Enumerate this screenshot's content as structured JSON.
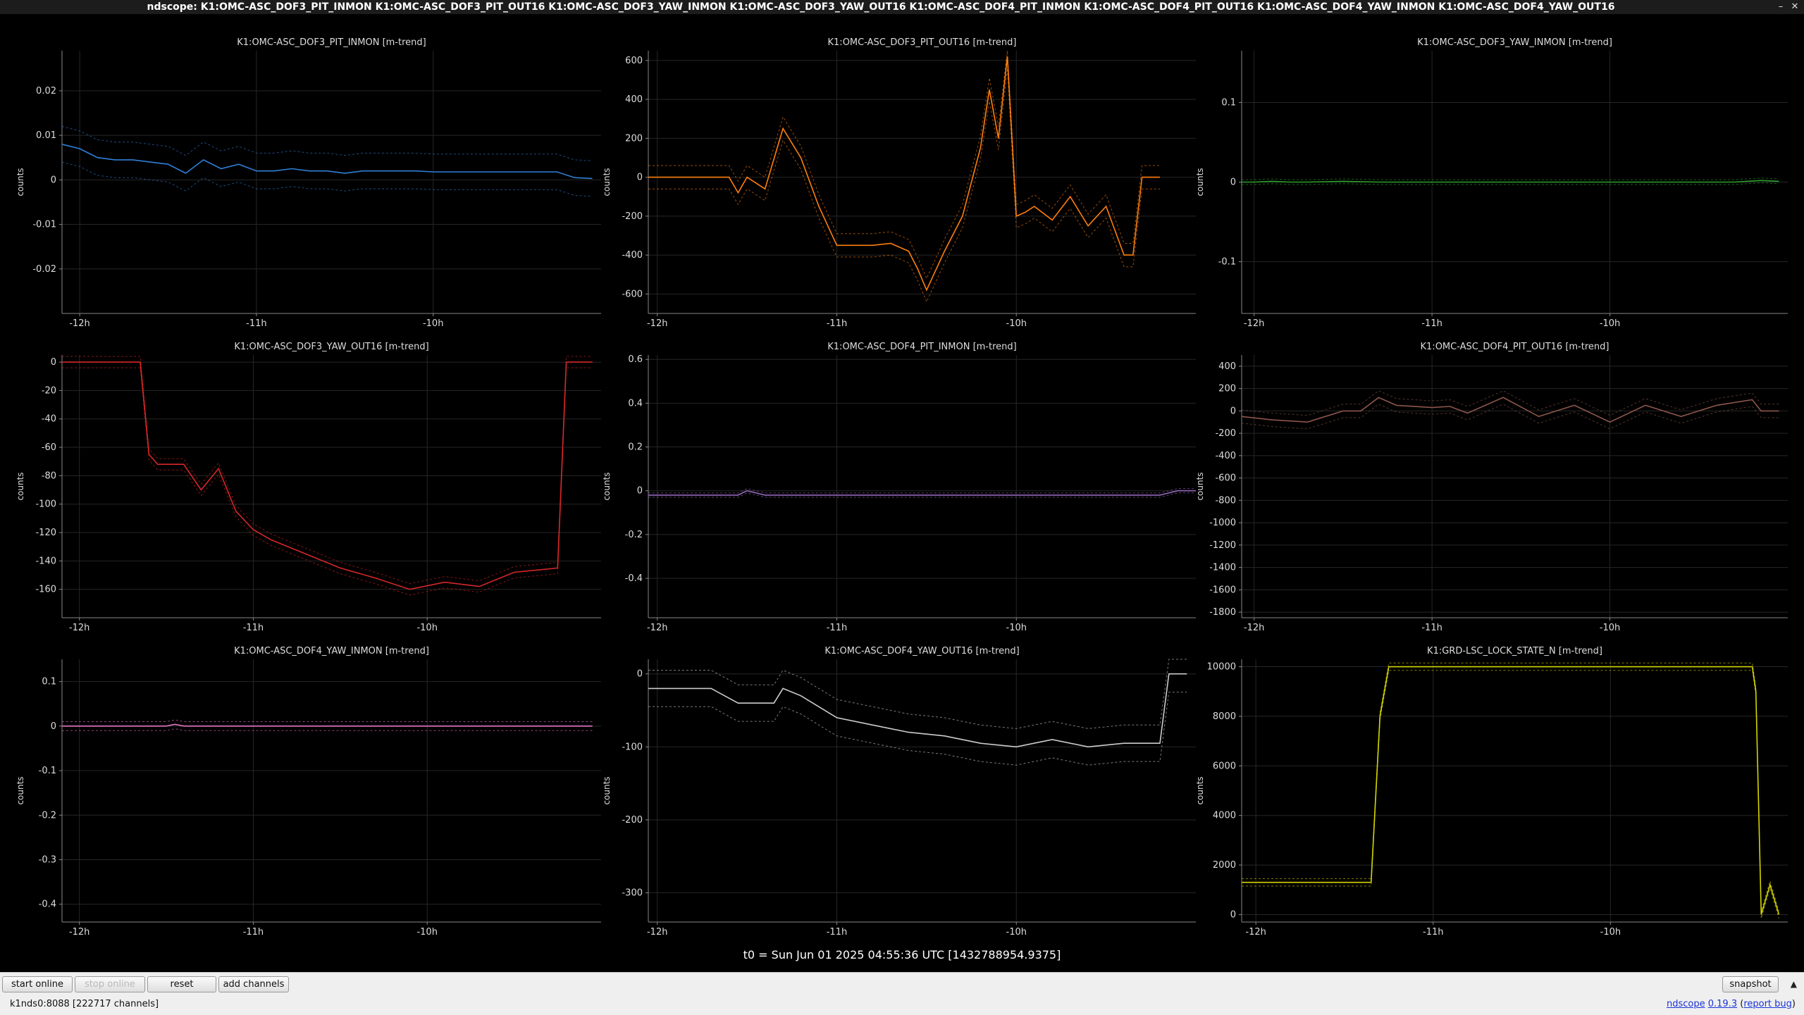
{
  "window": {
    "title": "ndscope: K1:OMC-ASC_DOF3_PIT_INMON K1:OMC-ASC_DOF3_PIT_OUT16 K1:OMC-ASC_DOF3_YAW_INMON K1:OMC-ASC_DOF3_YAW_OUT16 K1:OMC-ASC_DOF4_PIT_INMON K1:OMC-ASC_DOF4_PIT_OUT16 K1:OMC-ASC_DOF4_YAW_INMON K1:OMC-ASC_DOF4_YAW_OUT16",
    "minimize_icon": "minimize-icon",
    "close_icon": "close-icon"
  },
  "t0_label": "t0 = Sun Jun 01 2025 04:55:36 UTC [1432788954.9375]",
  "toolbar": {
    "start_online": "start online",
    "stop_online": "stop online",
    "reset": "reset",
    "add_channels": "add channels",
    "snapshot": "snapshot",
    "collapse_icon": "chevron-up-icon"
  },
  "status": {
    "server": "k1nds0:8088  [222717 channels]",
    "app_name": "ndscope",
    "version": "0.19.3",
    "report_bug": "report bug"
  },
  "chart_data": [
    {
      "type": "line",
      "title": "K1:OMC-ASC_DOF3_PIT_INMON [m-trend]",
      "ylabel": "counts",
      "color": "#2f7fd6",
      "xticks": [
        "-12h",
        "-11h",
        "-10h"
      ],
      "xlim": [
        -12.1,
        -9.05
      ],
      "ylim": [
        -0.03,
        0.029
      ],
      "yticks": [
        0.02,
        0.01,
        0,
        -0.01,
        -0.02
      ],
      "ytick_labels": [
        "0.02",
        "0.01",
        "0",
        "-0.01",
        "-0.02"
      ],
      "x": [
        -12.1,
        -12.0,
        -11.9,
        -11.8,
        -11.7,
        -11.6,
        -11.5,
        -11.4,
        -11.3,
        -11.2,
        -11.1,
        -11.0,
        -10.9,
        -10.8,
        -10.7,
        -10.6,
        -10.5,
        -10.4,
        -10.3,
        -10.2,
        -10.1,
        -10.0,
        -9.9,
        -9.8,
        -9.7,
        -9.6,
        -9.5,
        -9.4,
        -9.3,
        -9.2,
        -9.1
      ],
      "y": [
        0.008,
        0.007,
        0.005,
        0.0045,
        0.0045,
        0.004,
        0.0035,
        0.0015,
        0.0045,
        0.0025,
        0.0035,
        0.002,
        0.002,
        0.0025,
        0.002,
        0.002,
        0.0015,
        0.002,
        0.002,
        0.002,
        0.002,
        0.0018,
        0.0018,
        0.0018,
        0.0018,
        0.0018,
        0.0018,
        0.0018,
        0.0018,
        0.0005,
        0.0003
      ],
      "band": 0.004
    },
    {
      "type": "line",
      "title": "K1:OMC-ASC_DOF3_PIT_OUT16 [m-trend]",
      "ylabel": "counts",
      "color": "#ff7f0e",
      "xticks": [
        "-12h",
        "-11h",
        "-10h"
      ],
      "xlim": [
        -12.05,
        -9.0
      ],
      "ylim": [
        -700,
        650
      ],
      "yticks": [
        600,
        400,
        200,
        0,
        -200,
        -400,
        -600
      ],
      "ytick_labels": [
        "600",
        "400",
        "200",
        "0",
        "-200",
        "-400",
        "-600"
      ],
      "x": [
        -12.05,
        -11.9,
        -11.7,
        -11.6,
        -11.55,
        -11.5,
        -11.4,
        -11.3,
        -11.2,
        -11.1,
        -11.0,
        -10.9,
        -10.8,
        -10.7,
        -10.6,
        -10.55,
        -10.5,
        -10.4,
        -10.3,
        -10.2,
        -10.15,
        -10.1,
        -10.05,
        -10.0,
        -9.95,
        -9.9,
        -9.8,
        -9.7,
        -9.6,
        -9.5,
        -9.4,
        -9.35,
        -9.3,
        -9.2
      ],
      "y": [
        0,
        0,
        0,
        0,
        -80,
        0,
        -60,
        250,
        100,
        -150,
        -350,
        -350,
        -350,
        -340,
        -380,
        -470,
        -580,
        -380,
        -200,
        150,
        450,
        200,
        620,
        -200,
        -180,
        -150,
        -220,
        -100,
        -250,
        -150,
        -400,
        -400,
        0,
        0
      ],
      "band": 60
    },
    {
      "type": "line",
      "title": "K1:OMC-ASC_DOF3_YAW_INMON [m-trend]",
      "ylabel": "counts",
      "color": "#2ca02c",
      "xticks": [
        "-12h",
        "-11h",
        "-10h"
      ],
      "xlim": [
        -12.07,
        -9.0
      ],
      "ylim": [
        -0.165,
        0.165
      ],
      "yticks": [
        0.1,
        0,
        -0.1
      ],
      "ytick_labels": [
        "0.1",
        "0",
        "-0.1"
      ],
      "x": [
        -12.07,
        -12.0,
        -11.9,
        -11.8,
        -11.7,
        -11.5,
        -11.3,
        -11.0,
        -10.7,
        -10.4,
        -10.1,
        -9.8,
        -9.5,
        -9.3,
        -9.15,
        -9.05
      ],
      "y": [
        0,
        0,
        0.001,
        0,
        0,
        0.001,
        0,
        0,
        0,
        0,
        0,
        0,
        0,
        0,
        0.002,
        0.001
      ],
      "band": 0.003
    },
    {
      "type": "line",
      "title": "K1:OMC-ASC_DOF3_YAW_OUT16 [m-trend]",
      "ylabel": "counts",
      "color": "#d62728",
      "xticks": [
        "-12h",
        "-11h",
        "-10h"
      ],
      "xlim": [
        -12.1,
        -9.0
      ],
      "ylim": [
        -180,
        5
      ],
      "yticks": [
        0,
        -20,
        -40,
        -60,
        -80,
        -100,
        -120,
        -140,
        -160
      ],
      "ytick_labels": [
        "0",
        "-20",
        "-40",
        "-60",
        "-80",
        "-100",
        "-120",
        "-140",
        "-160"
      ],
      "x": [
        -12.1,
        -11.65,
        -11.6,
        -11.55,
        -11.4,
        -11.3,
        -11.2,
        -11.1,
        -11.0,
        -10.9,
        -10.7,
        -10.5,
        -10.3,
        -10.1,
        -9.9,
        -9.7,
        -9.5,
        -9.25,
        -9.2,
        -9.05
      ],
      "y": [
        0,
        0,
        -65,
        -72,
        -72,
        -90,
        -75,
        -105,
        -118,
        -125,
        -135,
        -145,
        -152,
        -160,
        -155,
        -158,
        -148,
        -145,
        0,
        0
      ],
      "band": 4
    },
    {
      "type": "line",
      "title": "K1:OMC-ASC_DOF4_PIT_INMON [m-trend]",
      "ylabel": "counts",
      "color": "#9467bd",
      "xticks": [
        "-12h",
        "-11h",
        "-10h"
      ],
      "xlim": [
        -12.05,
        -9.0
      ],
      "ylim": [
        -0.58,
        0.62
      ],
      "yticks": [
        0.6,
        0.4,
        0.2,
        0,
        -0.2,
        -0.4
      ],
      "ytick_labels": [
        "0.6",
        "0.4",
        "0.2",
        "0",
        "-0.2",
        "-0.4"
      ],
      "x": [
        -12.05,
        -11.8,
        -11.55,
        -11.5,
        -11.4,
        -11.0,
        -10.5,
        -10.0,
        -9.5,
        -9.2,
        -9.1,
        -9.0
      ],
      "y": [
        -0.02,
        -0.02,
        -0.02,
        0,
        -0.02,
        -0.02,
        -0.02,
        -0.02,
        -0.02,
        -0.02,
        0,
        0
      ],
      "band": 0.01
    },
    {
      "type": "line",
      "title": "K1:OMC-ASC_DOF4_PIT_OUT16 [m-trend]",
      "ylabel": "counts",
      "color": "#8c564b",
      "xticks": [
        "-12h",
        "-11h",
        "-10h"
      ],
      "xlim": [
        -12.07,
        -9.0
      ],
      "ylim": [
        -1850,
        500
      ],
      "yticks": [
        400,
        200,
        0,
        -200,
        -400,
        -600,
        -800,
        -1000,
        -1200,
        -1400,
        -1600,
        -1800
      ],
      "ytick_labels": [
        "400",
        "200",
        "0",
        "-200",
        "-400",
        "-600",
        "-800",
        "-1000",
        "-1200",
        "-1400",
        "-1600",
        "-1800"
      ],
      "x": [
        -12.07,
        -11.9,
        -11.7,
        -11.5,
        -11.4,
        -11.3,
        -11.2,
        -11.0,
        -10.9,
        -10.8,
        -10.6,
        -10.4,
        -10.2,
        -10.0,
        -9.8,
        -9.6,
        -9.4,
        -9.2,
        -9.15,
        -9.05
      ],
      "y": [
        -50,
        -80,
        -100,
        0,
        0,
        120,
        50,
        30,
        40,
        -20,
        120,
        -50,
        50,
        -100,
        50,
        -50,
        50,
        100,
        0,
        0
      ],
      "band": 60
    },
    {
      "type": "line",
      "title": "K1:OMC-ASC_DOF4_YAW_INMON [m-trend]",
      "ylabel": "counts",
      "color": "#e377c2",
      "xticks": [
        "-12h",
        "-11h",
        "-10h"
      ],
      "xlim": [
        -12.1,
        -9.0
      ],
      "ylim": [
        -0.44,
        0.15
      ],
      "yticks": [
        0.1,
        0,
        -0.1,
        -0.2,
        -0.3,
        -0.4
      ],
      "ytick_labels": [
        "0.1",
        "0",
        "-0.1",
        "-0.2",
        "-0.3",
        "-0.4"
      ],
      "x": [
        -12.1,
        -11.7,
        -11.5,
        -11.45,
        -11.4,
        -11.0,
        -10.5,
        -10.0,
        -9.5,
        -9.2,
        -9.1,
        -9.05
      ],
      "y": [
        0,
        0,
        0,
        0.004,
        0,
        0,
        0,
        0,
        0,
        0,
        0,
        0
      ],
      "band": 0.01
    },
    {
      "type": "line",
      "title": "K1:OMC-ASC_DOF4_YAW_OUT16 [m-trend]",
      "ylabel": "counts",
      "color": "#cccccc",
      "xticks": [
        "-12h",
        "-11h",
        "-10h"
      ],
      "xlim": [
        -12.05,
        -9.0
      ],
      "ylim": [
        -340,
        20
      ],
      "yticks": [
        0,
        -100,
        -200,
        -300
      ],
      "ytick_labels": [
        "0",
        "-100",
        "-200",
        "-300"
      ],
      "x": [
        -12.05,
        -11.9,
        -11.7,
        -11.55,
        -11.35,
        -11.3,
        -11.2,
        -11.0,
        -10.8,
        -10.6,
        -10.4,
        -10.2,
        -10.0,
        -9.8,
        -9.6,
        -9.4,
        -9.2,
        -9.15,
        -9.05
      ],
      "y": [
        -20,
        -20,
        -20,
        -40,
        -40,
        -20,
        -30,
        -60,
        -70,
        -80,
        -85,
        -95,
        -100,
        -90,
        -100,
        -95,
        -95,
        0,
        0
      ],
      "band": 25
    },
    {
      "type": "line",
      "title": "K1:GRD-LSC_LOCK_STATE_N [m-trend]",
      "ylabel": "counts",
      "color": "#d4d400",
      "xticks": [
        "-12h",
        "-11h",
        "-10h"
      ],
      "xlim": [
        -12.08,
        -9.0
      ],
      "ylim": [
        -300,
        10300
      ],
      "yticks": [
        10000,
        8000,
        6000,
        4000,
        2000,
        0
      ],
      "ytick_labels": [
        "10000",
        "8000",
        "6000",
        "4000",
        "2000",
        "0"
      ],
      "x": [
        -12.08,
        -11.35,
        -11.3,
        -11.25,
        -10.8,
        -10.3,
        -9.8,
        -9.5,
        -9.2,
        -9.18,
        -9.15,
        -9.1,
        -9.05
      ],
      "y": [
        1300,
        1300,
        8000,
        10000,
        10000,
        10000,
        10000,
        10000,
        10000,
        9000,
        0,
        1200,
        0
      ],
      "band": 150
    }
  ]
}
